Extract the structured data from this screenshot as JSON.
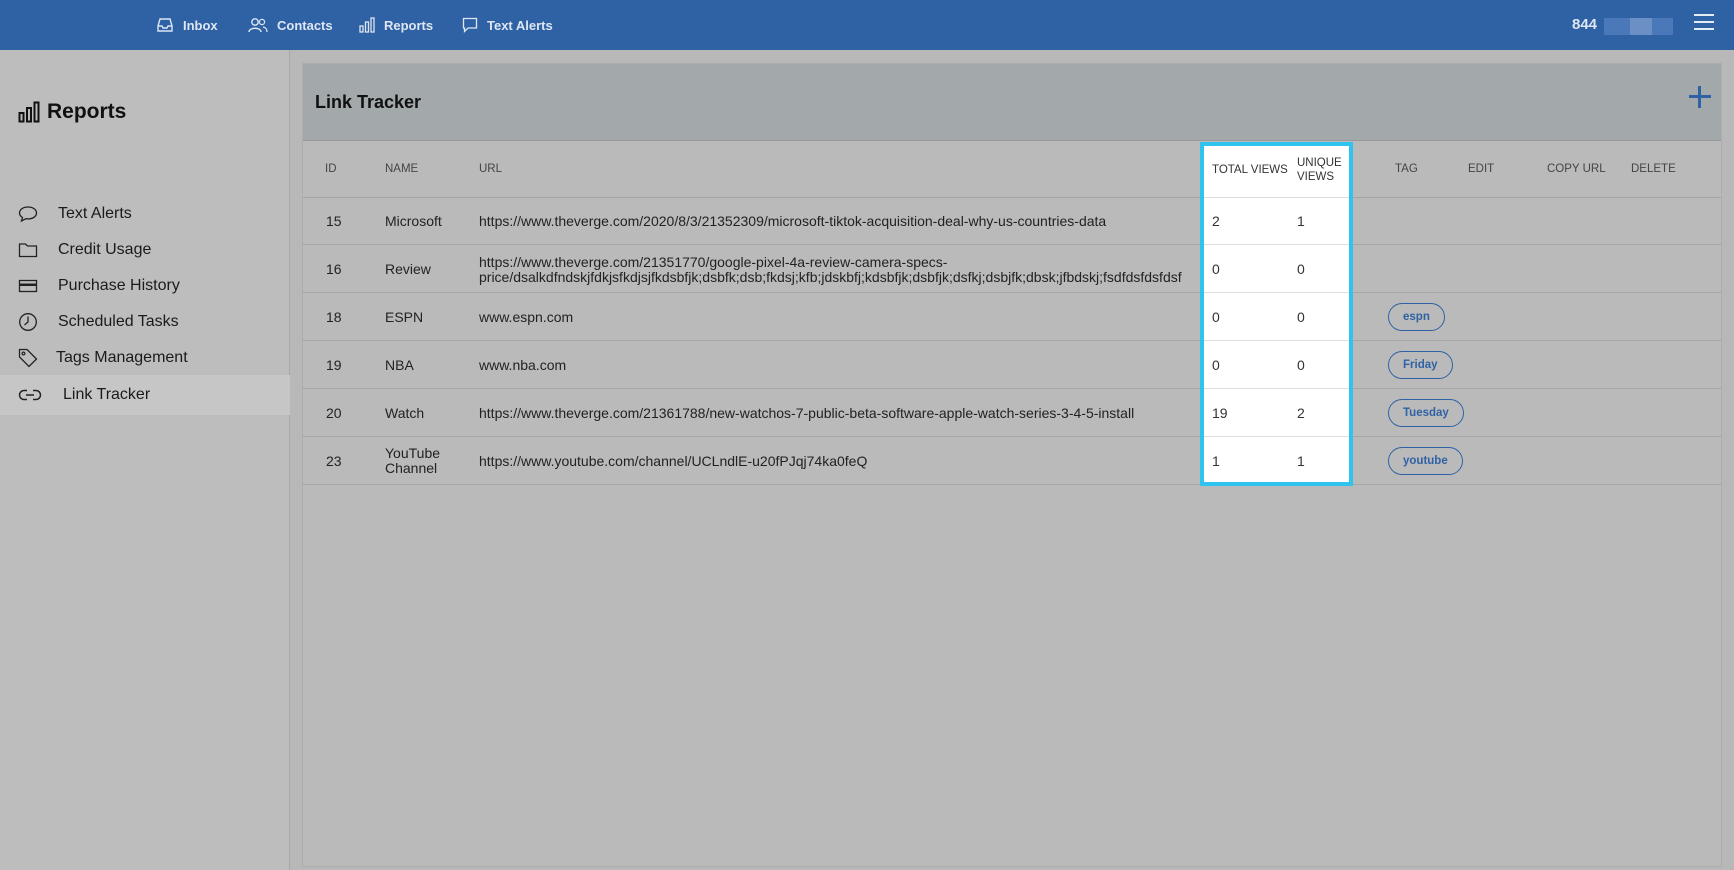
{
  "topnav": {
    "items": [
      {
        "label": "Inbox",
        "icon": "inbox-icon"
      },
      {
        "label": "Contacts",
        "icon": "contacts-icon"
      },
      {
        "label": "Reports",
        "icon": "bar-chart-icon"
      },
      {
        "label": "Text Alerts",
        "icon": "chat-bubble-icon"
      }
    ],
    "balance": "844"
  },
  "sidebar": {
    "title": "Reports",
    "items": [
      {
        "label": "Text Alerts",
        "icon": "chat-bubble-icon"
      },
      {
        "label": "Credit Usage",
        "icon": "folder-icon"
      },
      {
        "label": "Purchase History",
        "icon": "credit-card-icon"
      },
      {
        "label": "Scheduled Tasks",
        "icon": "clock-icon"
      },
      {
        "label": "Tags Management",
        "icon": "tag-icon"
      },
      {
        "label": "Link Tracker",
        "icon": "link-icon"
      }
    ],
    "active": "Link Tracker"
  },
  "main": {
    "title": "Link Tracker",
    "columns": {
      "id": "ID",
      "name": "NAME",
      "url": "URL",
      "total_views": "TOTAL VIEWS",
      "unique_views_1": "UNIQUE",
      "unique_views_2": "VIEWS",
      "tag": "TAG",
      "edit": "EDIT",
      "copy_url": "COPY URL",
      "delete": "DELETE"
    },
    "rows": [
      {
        "id": "15",
        "name": "Microsoft",
        "name2": "",
        "url": "https://www.theverge.com/2020/8/3/21352309/microsoft-tiktok-acquisition-deal-why-us-countries-data",
        "url2": "",
        "total": "2",
        "unique": "1",
        "tag": ""
      },
      {
        "id": "16",
        "name": "Review",
        "name2": "",
        "url": "https://www.theverge.com/21351770/google-pixel-4a-review-camera-specs-",
        "url2": "price/dsalkdfndskjfdkjsfkdjsjfkdsbfjk;dsbfk;dsb;fkdsj;kfb;jdskbfj;kdsbfjk;dsbfjk;dsfkj;dsbjfk;dbsk;jfbdskj;fsdfdsfdsfdsf",
        "total": "0",
        "unique": "0",
        "tag": ""
      },
      {
        "id": "18",
        "name": "ESPN",
        "name2": "",
        "url": "www.espn.com",
        "url2": "",
        "total": "0",
        "unique": "0",
        "tag": "espn"
      },
      {
        "id": "19",
        "name": "NBA",
        "name2": "",
        "url": "www.nba.com",
        "url2": "",
        "total": "0",
        "unique": "0",
        "tag": "Friday"
      },
      {
        "id": "20",
        "name": "Watch",
        "name2": "",
        "url": "https://www.theverge.com/21361788/new-watchos-7-public-beta-software-apple-watch-series-3-4-5-install",
        "url2": "",
        "total": "19",
        "unique": "2",
        "tag": "Tuesday"
      },
      {
        "id": "23",
        "name": "YouTube",
        "name2": "Channel",
        "url": "https://www.youtube.com/channel/UCLndlE-u20fPJqj74ka0feQ",
        "url2": "",
        "total": "1",
        "unique": "1",
        "tag": "youtube"
      }
    ]
  },
  "colors": {
    "topbar": "#2f62a4",
    "highlight_border": "#31c3ef",
    "tag_accent": "#2f62a4"
  }
}
